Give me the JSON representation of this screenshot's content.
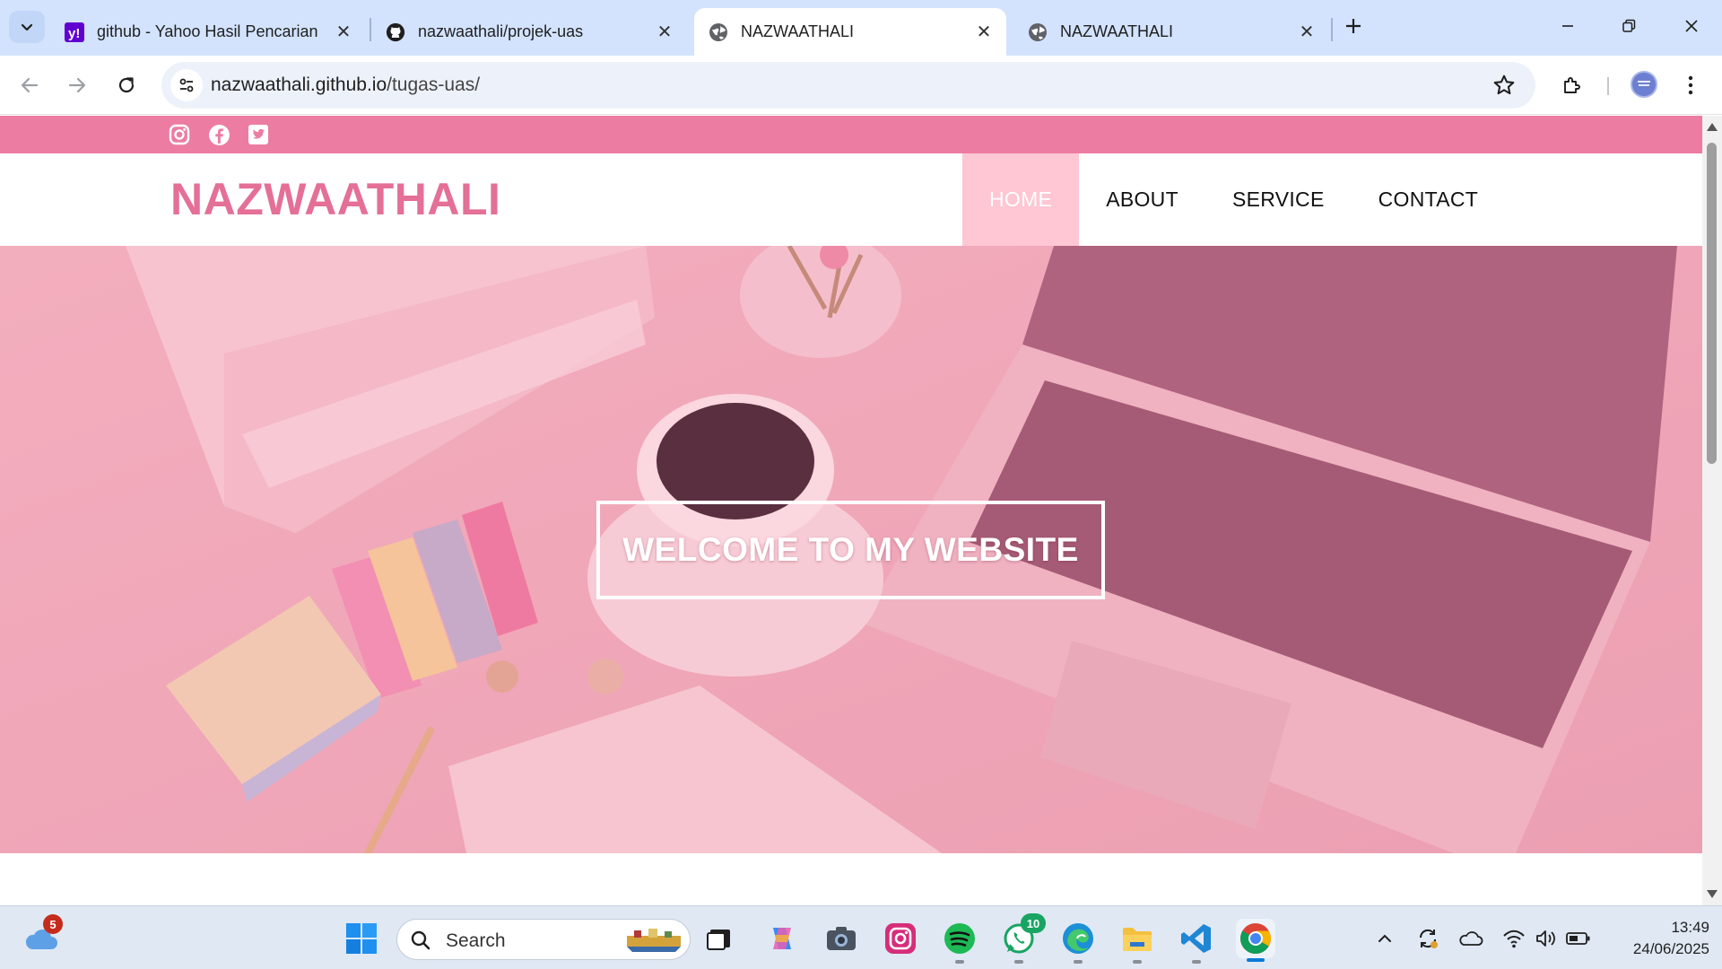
{
  "browser": {
    "tabs": [
      {
        "title": "github - Yahoo Hasil Pencarian",
        "icon": "yahoo-icon",
        "active": false
      },
      {
        "title": "nazwaathali/projek-uas",
        "icon": "github-icon",
        "active": false
      },
      {
        "title": "NAZWAATHALI",
        "icon": "globe-icon",
        "active": true
      },
      {
        "title": "NAZWAATHALI",
        "icon": "globe-icon",
        "active": false
      }
    ],
    "url_host": "nazwaathali.github.io",
    "url_path": "/tugas-uas/"
  },
  "site": {
    "brand": "NAZWAATHALI",
    "accent_color": "#ec7ca2",
    "social_icons": [
      "instagram-icon",
      "facebook-icon",
      "twitter-icon"
    ],
    "nav": [
      {
        "label": "HOME",
        "active": true
      },
      {
        "label": "ABOUT",
        "active": false
      },
      {
        "label": "SERVICE",
        "active": false
      },
      {
        "label": "CONTACT",
        "active": false
      }
    ],
    "hero_title": "WELCOME TO MY WEBSITE"
  },
  "taskbar": {
    "weather_badge": "5",
    "search_label": "Search",
    "whatsapp_badge": "10",
    "pinned_apps": [
      "windows-start-icon",
      "search",
      "task-view-icon",
      "copilot-icon",
      "camera-icon",
      "instagram-icon",
      "spotify-icon",
      "whatsapp-icon",
      "edge-icon",
      "file-explorer-icon",
      "vscode-icon",
      "chrome-icon"
    ],
    "time": "13:49",
    "date": "24/06/2025"
  }
}
